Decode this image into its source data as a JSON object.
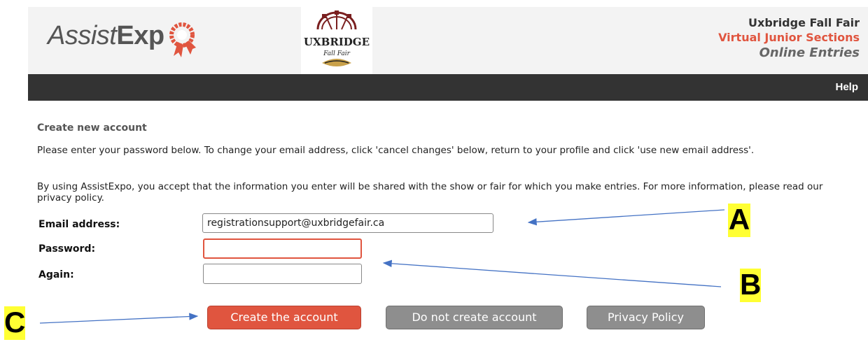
{
  "header": {
    "logo_light": "Assist",
    "logo_bold": "Exp",
    "fair_logo_text": "UXBRIDGE",
    "fair_logo_sub": "Fall Fair",
    "line1": "Uxbridge Fall Fair",
    "line2": "Virtual Junior Sections",
    "line3": "Online Entries"
  },
  "nav": {
    "help": "Help"
  },
  "form": {
    "title": "Create new account",
    "para1": "Please enter your password below. To change your email address, click 'cancel changes' below, return to your profile and click 'use new email address'.",
    "para2": "By using AssistExpo, you accept that the information you enter will be shared with the show or fair for which you make entries. For more information, please read our privacy policy.",
    "email_label": "Email address:",
    "email_value": "registrationsupport@uxbridgefair.ca",
    "password_label": "Password:",
    "password_value": "",
    "again_label": "Again:",
    "again_value": ""
  },
  "buttons": {
    "create": "Create the account",
    "cancel": "Do not create account",
    "privacy": "Privacy Policy"
  },
  "callouts": {
    "a": "A",
    "b": "B",
    "c": "C"
  },
  "colors": {
    "accent": "#e0553f",
    "nav_bg": "#333333",
    "header_bg": "#f3f3f3",
    "callout_bg": "#ffff33",
    "arrow": "#4472c4"
  }
}
